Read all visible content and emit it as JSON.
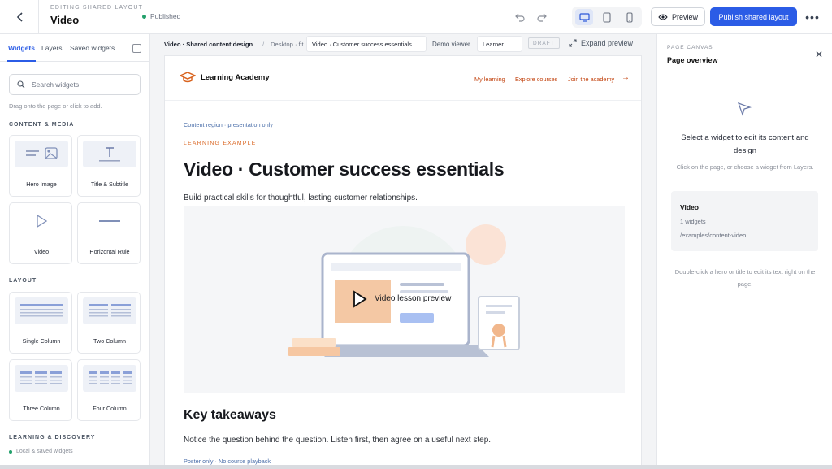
{
  "topbar": {
    "eyebrow": "EDITING SHARED LAYOUT",
    "title": "Video",
    "status": "Published",
    "preview_label": "Preview",
    "publish_label": "Publish shared layout",
    "more_label": "•••"
  },
  "left_panel": {
    "tabs": [
      "Widgets",
      "Layers",
      "Saved widgets"
    ],
    "search_placeholder": "Search widgets",
    "hint": "Drag onto the page or click to add.",
    "section_content": "CONTENT & MEDIA",
    "content_widgets": [
      "Hero Image",
      "Title & Subtitle",
      "Video",
      "Horizontal Rule"
    ],
    "section_layout": "LAYOUT",
    "layout_widgets": [
      "Single Column",
      "Two Column",
      "Three Column",
      "Four Column"
    ],
    "section_learning": "LEARNING & DISCOVERY",
    "footnote": "Local & saved widgets"
  },
  "canvas_bar": {
    "crumb_main": "Video · Shared content design",
    "crumb_sep": "/",
    "crumb_mode": "Desktop · fit",
    "page_select": "Video · Customer success essentials",
    "viewer_label": "Demo viewer",
    "viewer_value": "Learner",
    "draft_badge": "DRAFT",
    "expand_label": "Expand preview"
  },
  "page": {
    "brand": "Learning Academy",
    "nav": [
      "My learning",
      "Explore courses",
      "Join the academy"
    ],
    "region_note": "Content region · presentation only",
    "kicker": "LEARNING EXAMPLE",
    "heading": "Video · Customer success essentials",
    "subtitle": "Build practical skills for thoughtful, lasting customer relationships.",
    "video_label": "Video lesson preview",
    "section_heading": "Key takeaways",
    "section_body": "Notice the question behind the question. Listen first, then agree on a useful next step.",
    "poster_note": "Poster only · No course playback"
  },
  "right_panel": {
    "eyebrow": "PAGE CANVAS",
    "title": "Page overview",
    "message": "Select a widget to edit its content and design",
    "help": "Click on the page, or choose a widget from Layers.",
    "card_title": "Video",
    "card_count": "1 widgets",
    "card_path": "/examples/content-video",
    "footer": "Double-click a hero or title to edit its text right on the page."
  },
  "colors": {
    "accent": "#2b5ce6",
    "brand_orange": "#d9631e",
    "published": "#22a06b"
  }
}
